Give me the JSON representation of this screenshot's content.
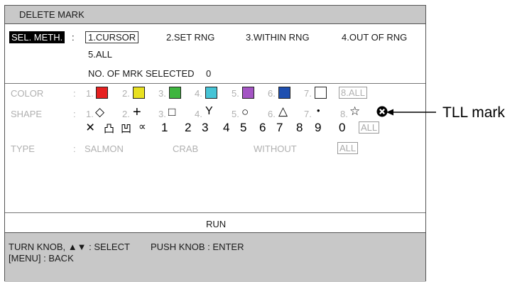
{
  "title": "DELETE MARK",
  "sel_meth": {
    "label": "SEL. METH.",
    "colon": ":",
    "options": [
      "1.CURSOR",
      "2.SET RNG",
      "3.WITHIN RNG",
      "4.OUT OF RNG",
      "5.ALL"
    ],
    "no_selected_label": "NO. OF MRK SELECTED",
    "no_selected_value": "0"
  },
  "color": {
    "label": "COLOR",
    "colon": ":",
    "items": [
      {
        "num": "1.",
        "swatch": "#e62020"
      },
      {
        "num": "2.",
        "swatch": "#e8e020"
      },
      {
        "num": "3.",
        "swatch": "#3fb53f"
      },
      {
        "num": "4.",
        "swatch": "#46c4d6"
      },
      {
        "num": "5.",
        "swatch": "#a455c4"
      },
      {
        "num": "6.",
        "swatch": "#1f4fb0"
      },
      {
        "num": "7.",
        "swatch": "#ffffff"
      }
    ],
    "all": "8.ALL"
  },
  "shape": {
    "label": "SHAPE",
    "colon": ":",
    "items": [
      {
        "num": "1.",
        "glyph": "◇",
        "icon": "diamond-icon"
      },
      {
        "num": "2.",
        "glyph": "+",
        "icon": "plus-icon"
      },
      {
        "num": "3.",
        "glyph": "□",
        "icon": "square-icon"
      },
      {
        "num": "4.",
        "glyph": "Y",
        "icon": "y-mark-icon"
      },
      {
        "num": "5.",
        "glyph": "○",
        "icon": "circle-icon"
      },
      {
        "num": "6.",
        "glyph": "△",
        "icon": "triangle-icon"
      },
      {
        "num": "7.",
        "glyph": "•",
        "icon": "dot-icon"
      },
      {
        "num": "8.",
        "glyph": "☆",
        "icon": "star-icon"
      }
    ],
    "row2_symbols": [
      "×",
      "凸",
      "凹",
      "∝"
    ],
    "digits": [
      "1",
      "2",
      "3",
      "4",
      "5",
      "6",
      "7",
      "8",
      "9",
      "0"
    ],
    "all": "ALL"
  },
  "type": {
    "label": "TYPE",
    "colon": ":",
    "options": [
      "SALMON",
      "CRAB",
      "WITHOUT"
    ],
    "all": "ALL"
  },
  "run": "RUN",
  "footer": {
    "line1a": "TURN KNOB, ▲▼ : SELECT",
    "line1b": "PUSH KNOB : ENTER",
    "line2": "[MENU] : BACK"
  },
  "callout": "TLL mark"
}
